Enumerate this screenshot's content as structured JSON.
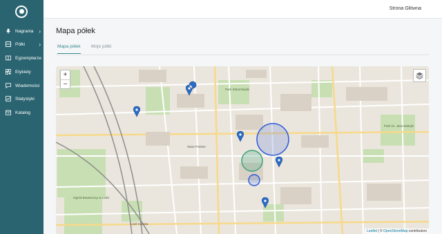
{
  "sidebar": {
    "items": [
      {
        "label": "Nagrania",
        "icon": "microphone-icon",
        "has_submenu": true
      },
      {
        "label": "Półki",
        "icon": "shelf-icon",
        "has_submenu": true
      },
      {
        "label": "Egzemplarze",
        "icon": "book-icon",
        "has_submenu": false
      },
      {
        "label": "Etykiety",
        "icon": "qr-code-icon",
        "has_submenu": false
      },
      {
        "label": "Wiadomości",
        "icon": "message-icon",
        "has_submenu": false
      },
      {
        "label": "Statystyki",
        "icon": "chart-icon",
        "has_submenu": false
      },
      {
        "label": "Katalog",
        "icon": "catalog-icon",
        "has_submenu": false
      }
    ]
  },
  "header": {
    "home_link": "Strona Główna"
  },
  "page": {
    "title": "Mapa półek",
    "tabs": [
      {
        "label": "Mapa półek",
        "active": true
      },
      {
        "label": "Moje półki",
        "active": false
      }
    ]
  },
  "map": {
    "zoom_in": "+",
    "zoom_out": "−",
    "labels": [
      "Park Staromiejski",
      "Ogród Botaniczny w Łodzi",
      "Łódź Kaliska",
      "Stare Polesie",
      "Park im. Jana Matejki"
    ],
    "attribution": {
      "leaflet": "Leaflet",
      "separator": " | © ",
      "osm": "OpenStreetMap",
      "suffix": " contributors"
    }
  },
  "colors": {
    "sidebar": "#2a6470",
    "accent": "#3b8a92",
    "marker": "#2b6cc4",
    "circle_blue": "#2e5bd8",
    "circle_green": "#3aa27a"
  }
}
